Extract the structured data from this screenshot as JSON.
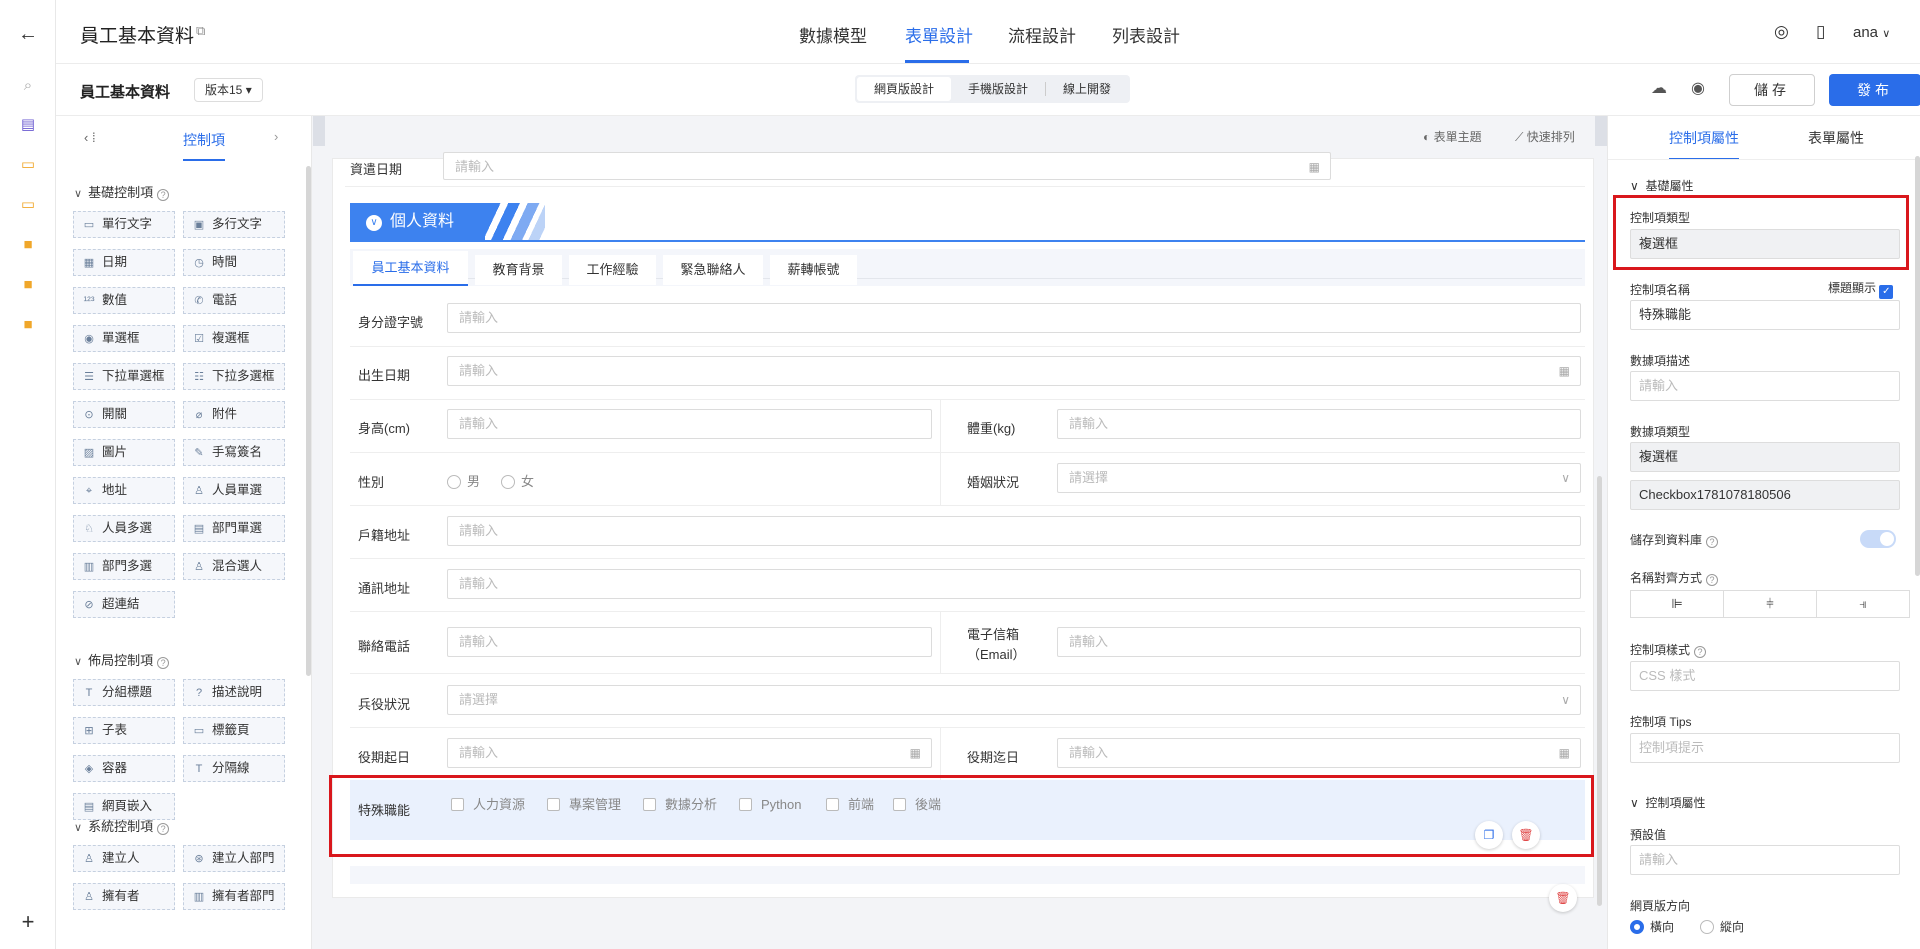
{
  "header": {
    "title": "員工基本資料",
    "tabs": [
      "數據模型",
      "表單設計",
      "流程設計",
      "列表設計"
    ],
    "user": "ana"
  },
  "subbar": {
    "form_name": "員工基本資料",
    "version": "版本15",
    "device_tabs": [
      "網頁版設計",
      "手機版設計",
      "線上開發"
    ],
    "save": "儲存",
    "publish": "發布"
  },
  "left_panel": {
    "tab_label": "控制項",
    "basic_title": "基礎控制項",
    "basic": [
      "單行文字",
      "多行文字",
      "日期",
      "時間",
      "數值",
      "電話",
      "單選框",
      "複選框",
      "下拉單選框",
      "下拉多選框",
      "開關",
      "附件",
      "圖片",
      "手寫簽名",
      "地址",
      "人員單選",
      "人員多選",
      "部門單選",
      "部門多選",
      "混合選人",
      "超連結"
    ],
    "layout_title": "佈局控制項",
    "layout": [
      "分組標題",
      "描述說明",
      "子表",
      "標籤頁",
      "容器",
      "分隔線",
      "網頁嵌入"
    ],
    "system_title": "系統控制項",
    "system": [
      "建立人",
      "建立人部門",
      "擁有者",
      "擁有者部門"
    ]
  },
  "canvas": {
    "toolbar": [
      "表單主題",
      "快速排列"
    ],
    "top_field": {
      "label": "資遣日期",
      "placeholder": "請輸入"
    },
    "group_title": "個人資料",
    "tabs": [
      "員工基本資料",
      "教育背景",
      "工作經驗",
      "緊急聯絡人",
      "薪轉帳號"
    ],
    "fields": {
      "id_no": "身分證字號",
      "birth": "出生日期",
      "height": "身高(cm)",
      "weight": "體重(kg)",
      "gender": "性別",
      "marital": "婚姻狀況",
      "household": "戶籍地址",
      "mailing": "通訊地址",
      "phone": "聯絡電話",
      "email": "電子信箱（Email）",
      "military": "兵役狀況",
      "service_start": "役期起日",
      "service_end": "役期迄日",
      "skills": "特殊職能"
    },
    "placeholder_input": "請輸入",
    "placeholder_select": "請選擇",
    "gender_options": [
      "男",
      "女"
    ],
    "skill_options": [
      "人力資源",
      "專案管理",
      "數據分析",
      "Python",
      "前端",
      "後端"
    ]
  },
  "right_panel": {
    "tabs": [
      "控制項屬性",
      "表單屬性"
    ],
    "basic_section": "基礎屬性",
    "control_type_label": "控制項類型",
    "control_type_value": "複選框",
    "control_name_label": "控制項名稱",
    "title_show_label": "標題顯示",
    "control_name_value": "特殊職能",
    "data_desc_label": "數據項描述",
    "data_desc_placeholder": "請輸入",
    "data_type_label": "數據項類型",
    "data_type_value": "複選框",
    "data_id": "Checkbox1781078180506",
    "save_db_label": "儲存到資料庫",
    "align_label": "名稱對齊方式",
    "style_label": "控制項樣式",
    "style_placeholder": "CSS 樣式",
    "tips_label": "控制項 Tips",
    "tips_placeholder": "控制項提示",
    "control_section": "控制項屬性",
    "default_label": "預設值",
    "default_placeholder": "請輸入",
    "direction_label": "網頁版方向",
    "direction_options": [
      "橫向",
      "縱向"
    ]
  }
}
